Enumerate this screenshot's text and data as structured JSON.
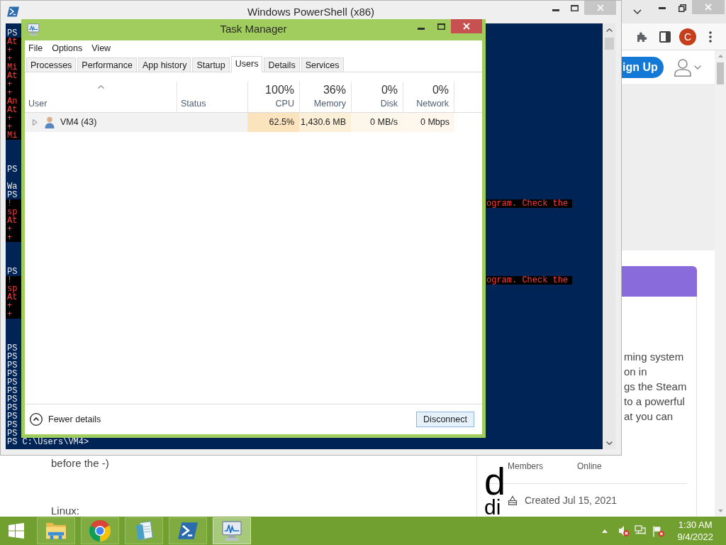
{
  "powershell": {
    "title": "Windows PowerShell (x86)",
    "lines": [
      {
        "kind": "plain",
        "left": "PS"
      },
      {
        "kind": "error",
        "left": "At"
      },
      {
        "kind": "error",
        "left": "+"
      },
      {
        "kind": "error",
        "left": "+"
      },
      {
        "kind": "error",
        "left": "Mi"
      },
      {
        "kind": "error",
        "left": "At"
      },
      {
        "kind": "error",
        "left": "+"
      },
      {
        "kind": "error",
        "left": "+"
      },
      {
        "kind": "error",
        "left": "An"
      },
      {
        "kind": "error",
        "left": "At"
      },
      {
        "kind": "error",
        "left": "+"
      },
      {
        "kind": "error",
        "left": "+"
      },
      {
        "kind": "error",
        "left": "Mi"
      },
      {
        "kind": "blank"
      },
      {
        "kind": "blank"
      },
      {
        "kind": "blank"
      },
      {
        "kind": "plain",
        "left": "PS"
      },
      {
        "kind": "blank"
      },
      {
        "kind": "plain",
        "left": "Wa"
      },
      {
        "kind": "plain",
        "left": "PS"
      },
      {
        "kind": "error",
        "left": "!",
        "right": "ogram. Check the"
      },
      {
        "kind": "error",
        "left": "sp"
      },
      {
        "kind": "error",
        "left": "At"
      },
      {
        "kind": "error",
        "left": "+"
      },
      {
        "kind": "error",
        "left": "+"
      },
      {
        "kind": "blank"
      },
      {
        "kind": "blank"
      },
      {
        "kind": "blank"
      },
      {
        "kind": "plain",
        "left": "PS"
      },
      {
        "kind": "error",
        "left": "!",
        "right": "ogram. Check the"
      },
      {
        "kind": "error",
        "left": "sp"
      },
      {
        "kind": "error",
        "left": "At"
      },
      {
        "kind": "error",
        "left": "+"
      },
      {
        "kind": "error",
        "left": "+"
      },
      {
        "kind": "blank"
      },
      {
        "kind": "blank"
      },
      {
        "kind": "blank"
      },
      {
        "kind": "plain",
        "left": "PS"
      },
      {
        "kind": "plain",
        "left": "PS"
      },
      {
        "kind": "plain",
        "left": "PS"
      },
      {
        "kind": "plain",
        "left": "PS"
      },
      {
        "kind": "plain",
        "left": "PS"
      },
      {
        "kind": "plain",
        "left": "PS"
      },
      {
        "kind": "plain",
        "left": "PS"
      },
      {
        "kind": "plain",
        "left": "PS"
      },
      {
        "kind": "plain",
        "left": "PS"
      },
      {
        "kind": "plain",
        "left": "PS"
      },
      {
        "kind": "plain",
        "left": "PS"
      },
      {
        "kind": "plain",
        "left": "PS C:\\Users\\VM4>"
      }
    ]
  },
  "task_manager": {
    "title": "Task Manager",
    "menu": [
      "File",
      "Options",
      "View"
    ],
    "tabs": [
      {
        "label": "Processes",
        "selected": false
      },
      {
        "label": "Performance",
        "selected": false
      },
      {
        "label": "App history",
        "selected": false
      },
      {
        "label": "Startup",
        "selected": false
      },
      {
        "label": "Users",
        "selected": true
      },
      {
        "label": "Details",
        "selected": false
      },
      {
        "label": "Services",
        "selected": false
      }
    ],
    "columns": [
      {
        "label": "User",
        "kind": "name",
        "sorted": true
      },
      {
        "label": "Status",
        "kind": "name",
        "sorted": false
      },
      {
        "label": "CPU",
        "kind": "usage",
        "summary": "100%",
        "sorted": false
      },
      {
        "label": "Memory",
        "kind": "usage",
        "summary": "36%",
        "sorted": false
      },
      {
        "label": "Disk",
        "kind": "usage",
        "summary": "0%",
        "sorted": false
      },
      {
        "label": "Network",
        "kind": "usage",
        "summary": "0%",
        "sorted": false
      }
    ],
    "rows": [
      {
        "expanded": false,
        "cells": [
          {
            "value": "VM4 (43)"
          },
          {},
          {
            "value": "62.5%",
            "color": "#fae3bd"
          },
          {
            "value": "1,430.6 MB",
            "color": "#fcefd8"
          },
          {
            "value": "0 MB/s",
            "color": "#fdf6eb"
          },
          {
            "value": "0 Mbps",
            "color": "#fdf7ee"
          }
        ]
      }
    ],
    "footer": {
      "toggle": "Fewer details",
      "button": "Disconnect"
    }
  },
  "browser": {
    "profile_initial": "C",
    "signup_button": "ign Up",
    "card": {
      "lines": [
        "ming system",
        "on in",
        "gs the Steam",
        "to a powerful",
        "at you can"
      ],
      "stats": [
        "Members",
        "Online"
      ],
      "letters": [
        "d",
        "di"
      ],
      "created": "Created Jul 15, 2021"
    },
    "article": [
      "before the -)",
      "Linux:"
    ]
  },
  "taskbar": {
    "apps": [
      {
        "kind": "folder",
        "active": false
      },
      {
        "kind": "browser",
        "active": false
      },
      {
        "kind": "notepad",
        "active": false
      },
      {
        "kind": "powershell",
        "active": false
      },
      {
        "kind": "monitor",
        "active": true
      }
    ],
    "clock": {
      "time": "1:30 AM",
      "date": "9/4/2022"
    }
  }
}
